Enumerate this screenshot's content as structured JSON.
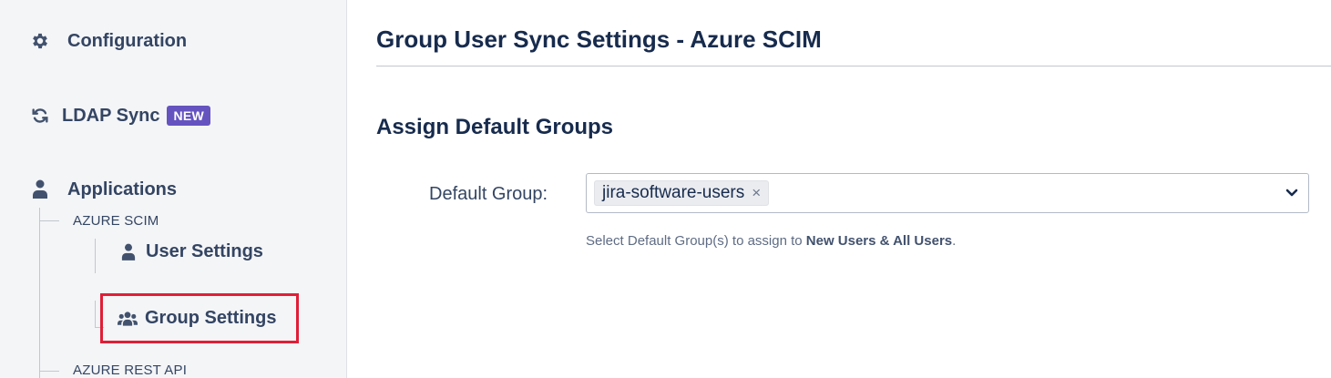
{
  "sidebar": {
    "configuration": {
      "label": "Configuration",
      "icon": "gear-icon"
    },
    "ldap_sync": {
      "label": "LDAP Sync",
      "badge": "NEW",
      "icon": "sync-icon"
    },
    "applications": {
      "label": "Applications",
      "icon": "user-icon"
    },
    "azure_scim": {
      "label": "AZURE SCIM",
      "items": [
        {
          "label": "User Settings",
          "icon": "user-icon"
        },
        {
          "label": "Group Settings",
          "icon": "users-group-icon",
          "selected": true
        }
      ]
    },
    "azure_rest_api": {
      "label": "AZURE REST API"
    }
  },
  "main": {
    "title": "Group User Sync Settings - Azure SCIM",
    "section_title": "Assign Default Groups",
    "default_group": {
      "label": "Default Group:",
      "selected_chip": "jira-software-users",
      "chip_remove": "×"
    },
    "help": {
      "prefix": "Select Default Group(s) to assign to ",
      "bold": "New Users & All Users",
      "suffix": "."
    }
  },
  "colors": {
    "badge": "#6554c0",
    "highlight_border": "#e01e37",
    "sidebar_bg": "#f4f5f7",
    "text_dark": "#172b4d"
  }
}
